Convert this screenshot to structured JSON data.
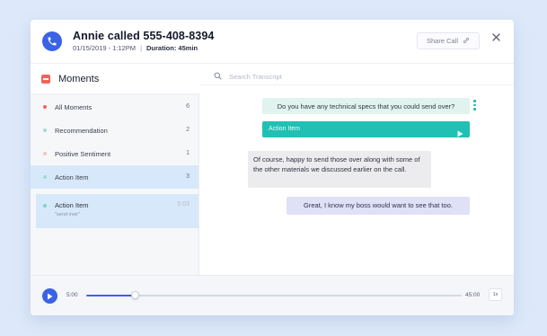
{
  "header": {
    "title": "Annie called 555-408-8394",
    "date": "01/15/2019 - 1:12PM",
    "separator": "|",
    "duration_label": "Duration: 45min",
    "share_label": "Share Call",
    "share_icon": "link-icon",
    "close_icon": "close-icon",
    "avatar_icon": "phone-icon",
    "accent_color": "#3b63e6"
  },
  "sidebar": {
    "title": "Moments",
    "items": [
      {
        "label": "All Moments",
        "count": "6",
        "dot_color": "#f0645a",
        "active": false
      },
      {
        "label": "Recommendation",
        "count": "2",
        "dot_color": "#9fdcd2",
        "active": false
      },
      {
        "label": "Positive Sentiment",
        "count": "1",
        "dot_color": "#f6c4c8",
        "active": false
      },
      {
        "label": "Action Item",
        "count": "3",
        "dot_color": "#9fdcd2",
        "active": true
      }
    ],
    "detail": {
      "label": "Action Item",
      "quote": "\"send over\"",
      "time": "5:03"
    }
  },
  "transcript": {
    "search_placeholder": "Search Transcript",
    "messages": [
      {
        "speaker": "agent",
        "text": "Do you have any technical specs that you could send over?",
        "color": "#e0f3ef"
      },
      {
        "speaker": "customer",
        "text": "Of course, happy to send those over along with some of the other materials we discussed earlier on the call.",
        "color": "#ececee"
      },
      {
        "speaker": "agent",
        "text": "Great, I know my boss would want to see that too.",
        "color": "#dfe2f6"
      }
    ],
    "action_bar": {
      "label": "Action Item",
      "color": "#20c1b4"
    }
  },
  "player": {
    "current_time": "5:00",
    "end_time": "45:00",
    "progress": 0.13,
    "speed": "1x"
  }
}
